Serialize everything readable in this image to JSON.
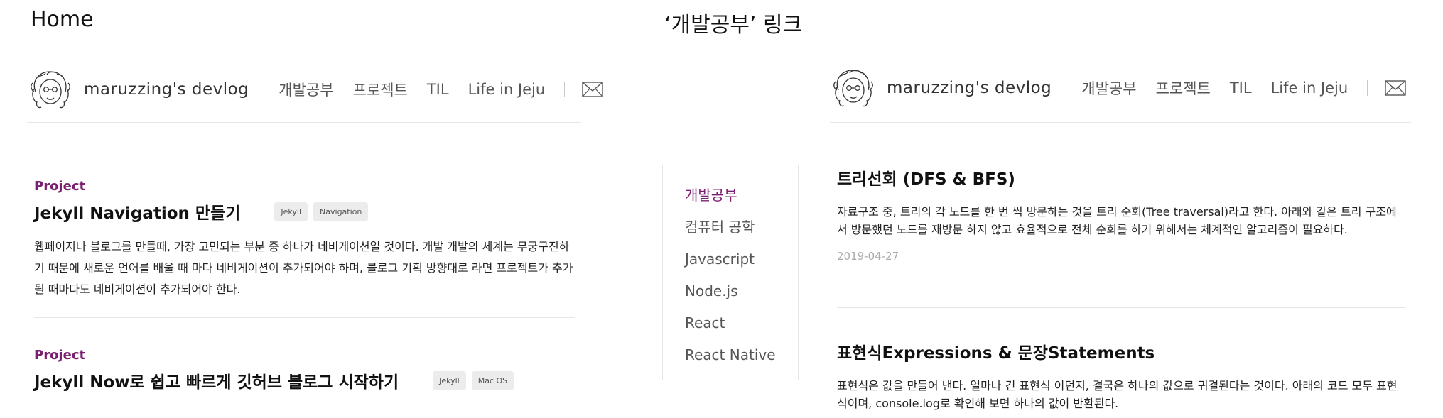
{
  "captions": {
    "left": "Home",
    "right": "‘개발공부’ 링크"
  },
  "site": {
    "title": "maruzzing's devlog",
    "avatar_icon": "avatar-sketch-icon",
    "mail_icon": "envelope-icon",
    "accent_color": "#7b1f70"
  },
  "nav": {
    "items": [
      {
        "label": "개발공부"
      },
      {
        "label": "프로젝트"
      },
      {
        "label": "TIL"
      },
      {
        "label": "Life in Jeju"
      }
    ]
  },
  "home": {
    "posts": [
      {
        "category": "Project",
        "title": "Jekyll Navigation 만들기",
        "tags": [
          "Jekyll",
          "Navigation"
        ],
        "excerpt": "웹페이지나 블로그를 만들때, 가장 고민되는 부분 중 하나가 네비게이션일 것이다. 개발 개발의 세계는 무궁구진하기 때문에 새로운 언어를 배울 때 마다 네비게이션이 추가되어야 하며, 블로그 기획 방향대로 라면 프로젝트가 추가될 때마다도 네비게이션이 추가되어야 한다."
      },
      {
        "category": "Project",
        "title": "Jekyll Now로 쉽고 빠르게 깃허브 블로그 시작하기",
        "tags": [
          "Jekyll",
          "Mac OS"
        ]
      }
    ]
  },
  "dev": {
    "sidebar": {
      "items": [
        {
          "label": "개발공부",
          "active": true
        },
        {
          "label": "컴퓨터 공학"
        },
        {
          "label": "Javascript"
        },
        {
          "label": "Node.js"
        },
        {
          "label": "React"
        },
        {
          "label": "React Native"
        }
      ]
    },
    "posts": [
      {
        "title": "트리선회 (DFS & BFS)",
        "excerpt": "자료구조 중, 트리의 각 노드를 한 번 씩 방문하는 것을 트리 순회(Tree traversal)라고 한다. 아래와 같은 트리 구조에서 방문했던 노드를 재방문 하지 않고 효율적으로 전체 순회를 하기 위해서는 체계적인 알고리즘이 필요하다.",
        "date": "2019-04-27"
      },
      {
        "title": "표현식Expressions & 문장Statements",
        "excerpt": "표현식은 값을 만들어 낸다. 얼마나 긴 표현식 이던지, 결국은 하나의 값으로 귀결된다는 것이다. 아래의 코드 모두 표현식이며, console.log로 확인해 보면 하나의 값이 반환된다."
      }
    ]
  }
}
